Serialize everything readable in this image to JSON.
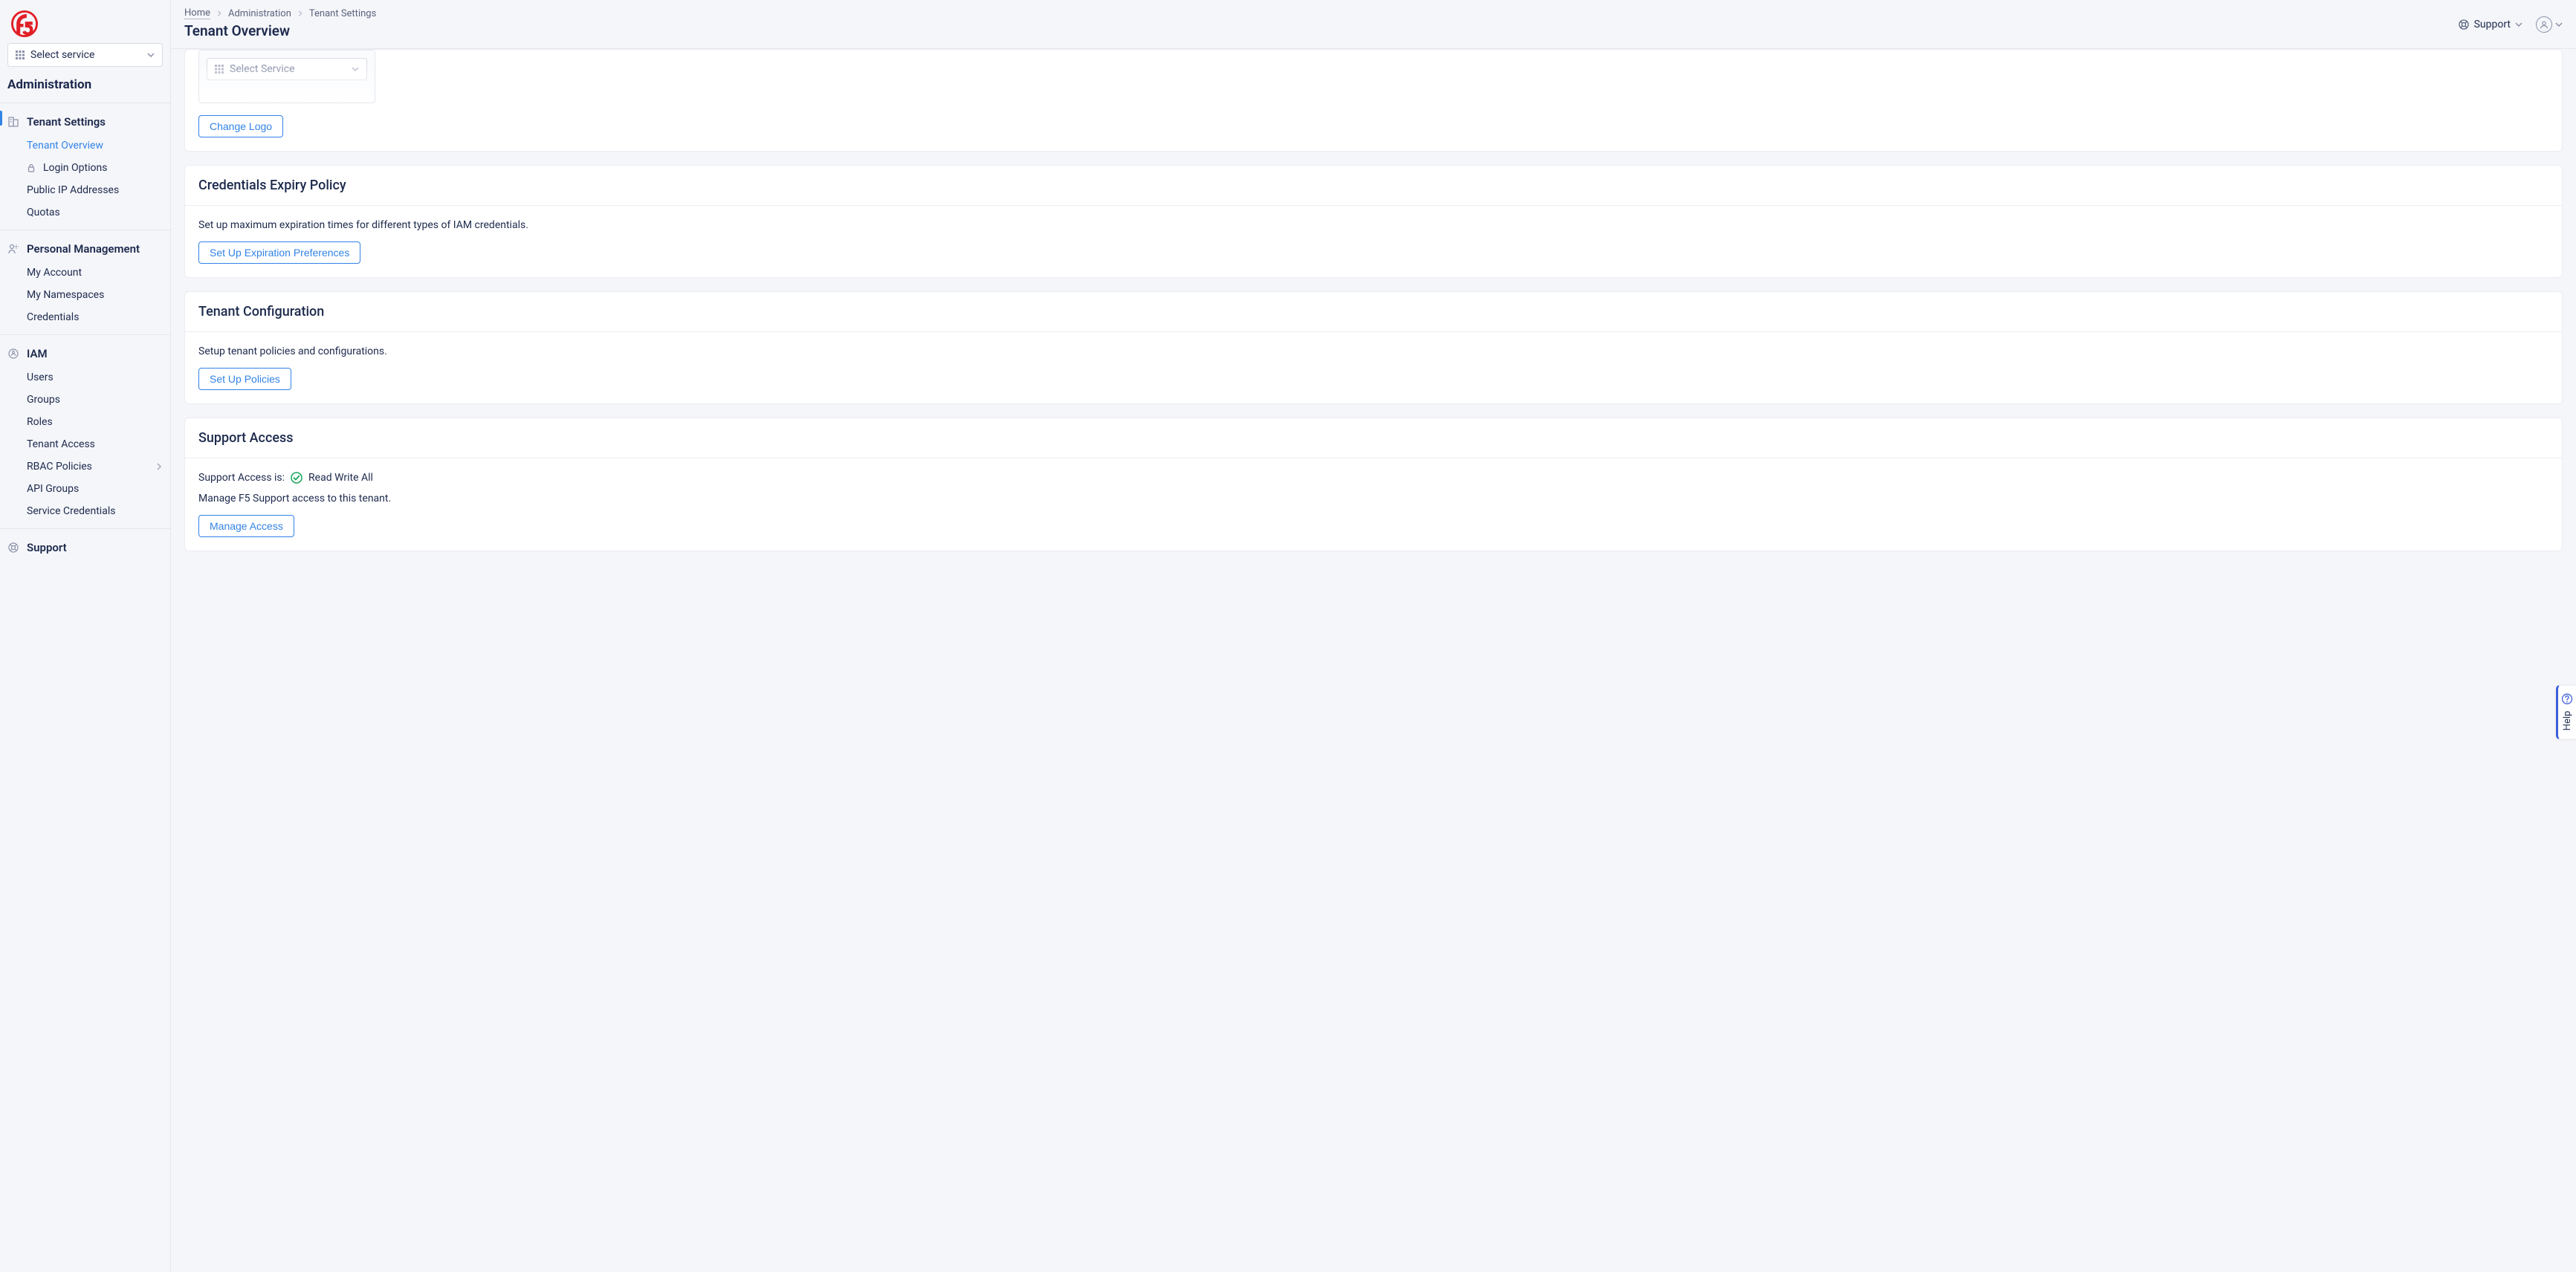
{
  "sidebar": {
    "service_select_label": "Select service",
    "title": "Administration",
    "sections": [
      {
        "title": "Tenant Settings",
        "items": [
          {
            "label": "Tenant Overview",
            "active": true
          },
          {
            "label": "Login Options",
            "lock": true
          },
          {
            "label": "Public IP Addresses"
          },
          {
            "label": "Quotas"
          }
        ]
      },
      {
        "title": "Personal Management",
        "items": [
          {
            "label": "My Account"
          },
          {
            "label": "My Namespaces"
          },
          {
            "label": "Credentials"
          }
        ]
      },
      {
        "title": "IAM",
        "items": [
          {
            "label": "Users"
          },
          {
            "label": "Groups"
          },
          {
            "label": "Roles"
          },
          {
            "label": "Tenant Access"
          },
          {
            "label": "RBAC Policies",
            "chev": true
          },
          {
            "label": "API Groups"
          },
          {
            "label": "Service Credentials"
          }
        ]
      },
      {
        "title": "Support",
        "items": []
      }
    ]
  },
  "breadcrumb": {
    "0": "Home",
    "1": "Administration",
    "2": "Tenant Settings"
  },
  "page_title": "Tenant Overview",
  "topbar": {
    "support_label": "Support"
  },
  "cards": {
    "logo": {
      "preview_select": "Select Service",
      "button": "Change Logo"
    },
    "creds": {
      "title": "Credentials Expiry Policy",
      "desc": "Set up maximum expiration times for different types of IAM credentials.",
      "button": "Set Up Expiration Preferences"
    },
    "tenant": {
      "title": "Tenant Configuration",
      "desc": "Setup tenant policies and configurations.",
      "button": "Set Up Policies"
    },
    "support": {
      "title": "Support Access",
      "status_label": "Support Access is:",
      "status_value": "Read Write All",
      "desc": "Manage F5 Support access to this tenant.",
      "button": "Manage Access"
    }
  },
  "help_flap": "Help"
}
